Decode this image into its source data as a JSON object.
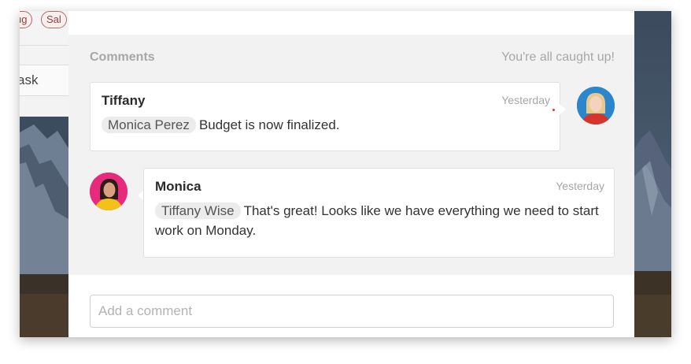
{
  "background_window": {
    "tags": [
      "ug",
      "Sal"
    ],
    "task_text": "ask"
  },
  "comments": {
    "title": "Comments",
    "status": "You're all caught up!",
    "items": [
      {
        "author": "Tiffany",
        "time": "Yesterday",
        "mention": "Monica  Perez",
        "text": "Budget is now finalized.",
        "avatar_side": "right"
      },
      {
        "author": "Monica",
        "time": "Yesterday",
        "mention": "Tiffany Wise",
        "text": "That's great! Looks like we have everything we need to start work on Monday.",
        "avatar_side": "left"
      }
    ]
  },
  "composer": {
    "placeholder": "Add a comment",
    "value": ""
  },
  "colors": {
    "panel_background": "#f2f2f2",
    "card_background": "#ffffff",
    "muted_text": "#a7a7a7",
    "mention_chip": "#ececec",
    "unread_dot": "#d23b3b",
    "tag_border": "#b56a6a"
  }
}
